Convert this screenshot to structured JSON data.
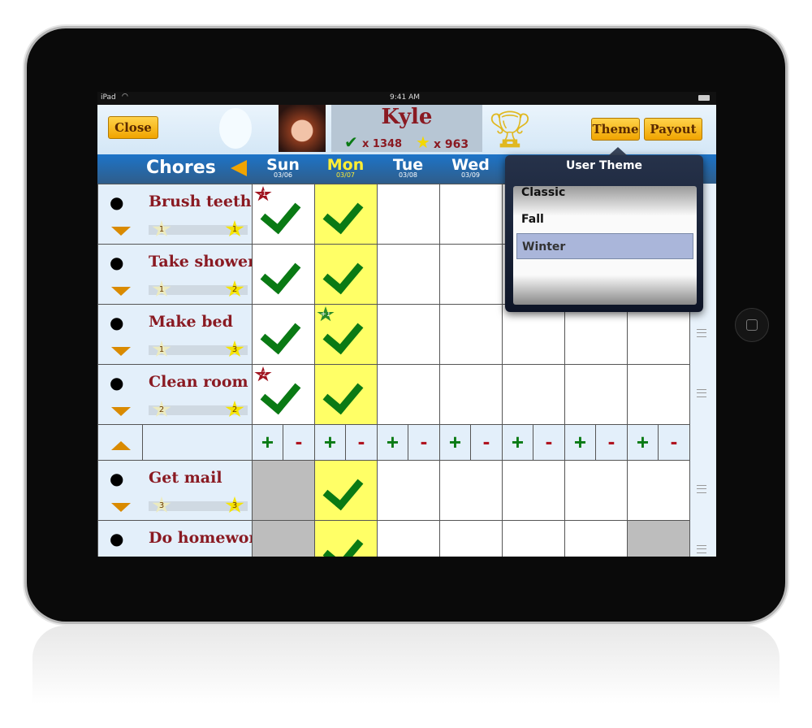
{
  "status": {
    "device": "iPad",
    "time": "9:41 AM"
  },
  "header": {
    "close_label": "Close",
    "user_name": "Kyle",
    "checks_count": "x 1348",
    "stars_count": "x 963",
    "theme_label": "Theme",
    "payout_label": "Payout",
    "chores_label": "Chores"
  },
  "days": [
    {
      "name": "Sun",
      "date": "03/06"
    },
    {
      "name": "Mon",
      "date": "03/07",
      "today": true
    },
    {
      "name": "Tue",
      "date": "03/08"
    },
    {
      "name": "Wed",
      "date": "03/09"
    }
  ],
  "chores": [
    {
      "name": "Brush teeth AM",
      "icon": "toothbrush-icon",
      "min_stars": "1",
      "max_stars": "1",
      "cells": [
        {
          "check": true,
          "badge": "-1"
        },
        {
          "check": true
        },
        {},
        {},
        {},
        {},
        {}
      ]
    },
    {
      "name": "Take shower",
      "icon": "water-drop-icon",
      "min_stars": "1",
      "max_stars": "2",
      "cells": [
        {
          "check": true
        },
        {
          "check": true
        },
        {},
        {},
        {},
        {},
        {}
      ]
    },
    {
      "name": "Make bed",
      "icon": "bed-icon",
      "min_stars": "1",
      "max_stars": "3",
      "cells": [
        {
          "check": true
        },
        {
          "check": true,
          "badge": "+1"
        },
        {},
        {},
        {},
        {},
        {}
      ]
    },
    {
      "name": "Clean room",
      "icon": "vacuum-icon",
      "min_stars": "2",
      "max_stars": "2",
      "cells": [
        {
          "check": true,
          "badge": "-2"
        },
        {
          "check": true
        },
        {},
        {},
        {},
        {},
        {}
      ]
    },
    {
      "name": "Get mail",
      "icon": "mailbox-icon",
      "min_stars": "3",
      "max_stars": "3",
      "cells": [
        {
          "disabled": true
        },
        {
          "check": true
        },
        {},
        {},
        {},
        {},
        {}
      ]
    },
    {
      "name": "Do homework",
      "icon": "backpack-icon",
      "cells": [
        {
          "disabled": true
        },
        {
          "check": true
        },
        {},
        {},
        {},
        {},
        {
          "disabled": true
        }
      ]
    }
  ],
  "adjust": {
    "plus": "+",
    "minus": "-"
  },
  "popover": {
    "title": "User Theme",
    "options": [
      "Classic",
      "Fall",
      "Winter"
    ],
    "selected": "Winter"
  },
  "colors": {
    "today": "#ffff66",
    "check": "#0a7a14",
    "penalty": "#a01420",
    "bonus": "#2a8a2a",
    "disabled": "#bdbdbd"
  }
}
